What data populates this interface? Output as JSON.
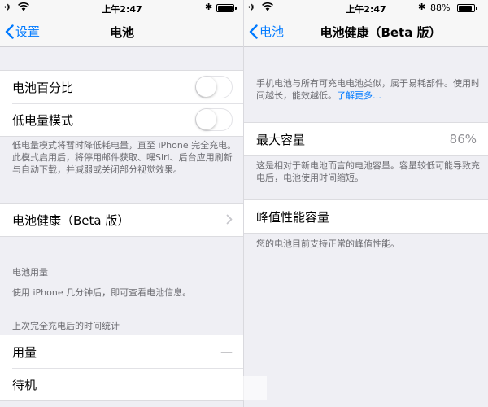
{
  "status_bar": {
    "time": "上午2:47",
    "battery_percent": "88%",
    "battery_level": 0.88
  },
  "left": {
    "nav": {
      "back_label": "设置",
      "title": "电池"
    },
    "toggles": [
      {
        "label": "电池百分比",
        "on": false
      },
      {
        "label": "低电量模式",
        "on": false
      }
    ],
    "low_power_footnote": "低电量模式将暂时降低耗电量，直至 iPhone 完全充电。此模式启用后，将停用邮件获取、嘿Siri、后台应用刷新与自动下载，并减弱或关闭部分视觉效果。",
    "battery_health_label": "电池健康（Beta 版）",
    "usage_header": "电池用量",
    "usage_note": "使用 iPhone 几分钟后，即可查看电池信息。",
    "since_charge_header": "上次完全充电后的时间统计",
    "stats": [
      {
        "label": "用量",
        "value": "—"
      },
      {
        "label": "待机",
        "value": ""
      }
    ]
  },
  "right": {
    "nav": {
      "back_label": "电池",
      "title": "电池健康（Beta 版）"
    },
    "intro": "手机电池与所有可充电电池类似，属于易耗部件。使用时间越长，能效越低。",
    "learn_more": "了解更多…",
    "max_capacity": {
      "label": "最大容量",
      "value": "86%"
    },
    "max_capacity_note": "这是相对于新电池而言的电池容量。容量较低可能导致充电后，电池使用时间缩短。",
    "peak_performance": {
      "label": "峰值性能容量"
    },
    "peak_note": "您的电池目前支持正常的峰值性能。"
  },
  "colors": {
    "accent": "#007aff",
    "background": "#efeff4",
    "secondary_text": "#6d6d72"
  },
  "icons": [
    "airplane-icon",
    "wifi-icon",
    "bluetooth-icon",
    "battery-icon",
    "chevron-left-icon",
    "chevron-right-icon"
  ]
}
